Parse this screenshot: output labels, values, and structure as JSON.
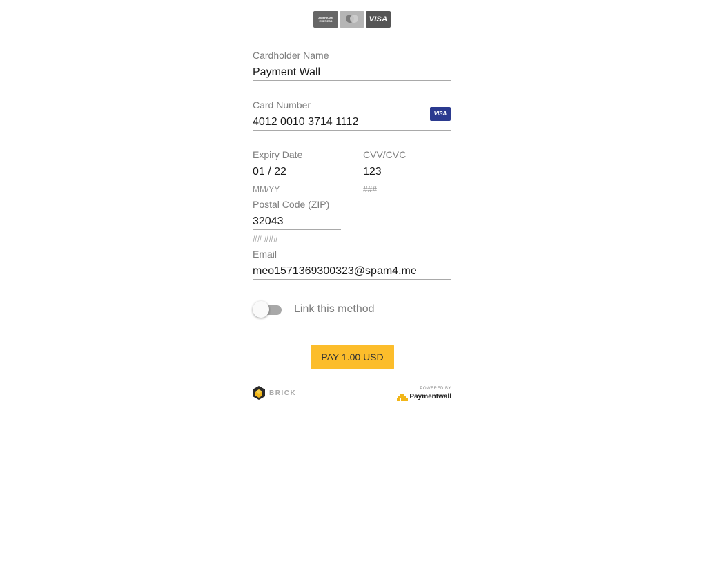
{
  "brands": {
    "amex_line1": "AMERICAN",
    "amex_line2": "EXPRESS",
    "mastercard": "mastercard",
    "visa": "VISA"
  },
  "cardholder": {
    "label": "Cardholder Name",
    "value": "Payment Wall"
  },
  "card_number": {
    "label": "Card Number",
    "value": "4012 0010 3714 1112",
    "detected_brand": "VISA"
  },
  "expiry": {
    "label": "Expiry Date",
    "value": "01 / 22",
    "hint": "MM/YY"
  },
  "cvv": {
    "label": "CVV/CVC",
    "value": "123",
    "hint": "###"
  },
  "postal": {
    "label": "Postal Code (ZIP)",
    "value": "32043",
    "hint": "## ###"
  },
  "email": {
    "label": "Email",
    "value": "meo1571369300323@spam4.me"
  },
  "link_method": {
    "label": "Link this method",
    "enabled": false
  },
  "pay_button": {
    "label": "PAY 1.00 USD",
    "color": "#fcbd2b"
  },
  "footer": {
    "brick": "BRICK",
    "powered_by": "POWERED BY",
    "paymentwall": "Paymentwall"
  }
}
